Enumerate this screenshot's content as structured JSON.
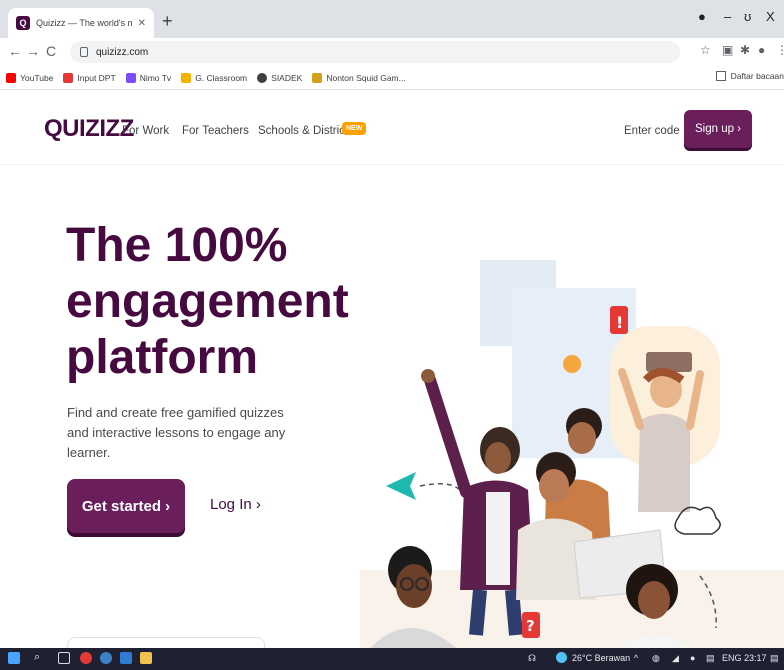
{
  "browser": {
    "tab_title": "Quizizz — The world's most enga",
    "tab_favicon": "Q",
    "url": "quizizz.com",
    "window_minimize": "–",
    "window_maximize": "ʊ",
    "window_close": "X"
  },
  "bookmarks": [
    {
      "label": "YouTube",
      "color": "#ff0000"
    },
    {
      "label": "Input DPT",
      "color": "#e53935"
    },
    {
      "label": "Nimo Tv",
      "color": "#7c4dff"
    },
    {
      "label": "G. Classroom",
      "color": "#f4b400"
    },
    {
      "label": "SIADEK",
      "color": "#3c4043"
    },
    {
      "label": "Nonton Squid Gam...",
      "color": "#d4a017"
    }
  ],
  "bookmarks_right": "Daftar bacaan",
  "site": {
    "logo": "QUIZIZZ",
    "nav": {
      "for_work": "For Work",
      "for_teachers": "For Teachers",
      "schools": "Schools & Districts",
      "badge": "NEW",
      "enter_code": "Enter code",
      "signup": "Sign up ›"
    },
    "hero": {
      "title": "The 100% engagement platform",
      "subtitle": "Find and create free gamified quizzes and interactive lessons to engage any learner.",
      "get_started": "Get started ›",
      "login": "Log In ›"
    }
  },
  "taskbar": {
    "weather": "26°C  Berawan",
    "lang": "ENG",
    "time": "23:17"
  },
  "colors": {
    "brand": "#460a40",
    "button": "#6a1f5c",
    "badge": "#ffa000"
  }
}
